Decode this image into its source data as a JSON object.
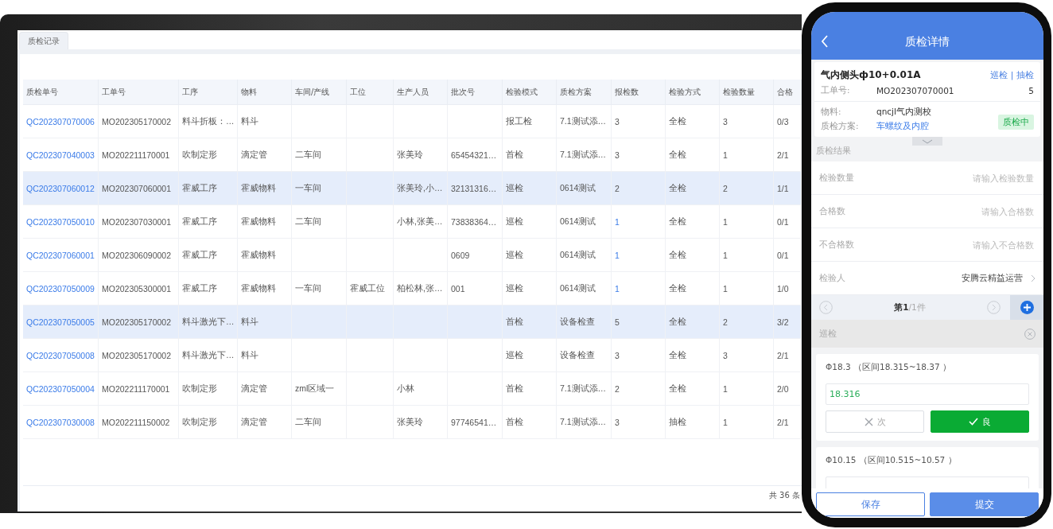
{
  "desktop": {
    "tabs": [
      {
        "label": "质检记录",
        "selected": true
      }
    ],
    "table": {
      "columns": [
        "质检单号",
        "工单号",
        "工序",
        "物料",
        "车间/产线",
        "工位",
        "生产人员",
        "批次号",
        "检验模式",
        "质检方案",
        "报检数",
        "检验方式",
        "检验数量",
        "合格"
      ],
      "rows": [
        {
          "selected": false,
          "report_linked": false,
          "cells": [
            "QC202307070006",
            "MO202305170002",
            "料斗折板：…",
            "料斗",
            "",
            "",
            "",
            "",
            "报工检",
            "7.1测试添…",
            "3",
            "全检",
            "3",
            "0/3"
          ]
        },
        {
          "selected": false,
          "report_linked": false,
          "cells": [
            "QC202307040003",
            "MO202211170001",
            "吹制定形",
            "滴定管",
            "二车间",
            "",
            "张美玲",
            "65454321…",
            "首检",
            "7.1测试添…",
            "3",
            "全检",
            "1",
            "2/1"
          ]
        },
        {
          "selected": true,
          "report_linked": false,
          "cells": [
            "QC202307060012",
            "MO202307060001",
            "霍威工序",
            "霍威物料",
            "一车间",
            "",
            "张美玲,小…",
            "32131316…",
            "巡检",
            "0614测试",
            "2",
            "全检",
            "2",
            "1/1"
          ]
        },
        {
          "selected": false,
          "report_linked": true,
          "cells": [
            "QC202307050010",
            "MO202307030001",
            "霍威工序",
            "霍威物料",
            "二车间",
            "",
            "小林,张美…",
            "73838364…",
            "巡检",
            "0614测试",
            "1",
            "全检",
            "1",
            "0/1"
          ]
        },
        {
          "selected": false,
          "report_linked": true,
          "cells": [
            "QC202307060001",
            "MO202306090002",
            "霍威工序",
            "霍威物料",
            "",
            "",
            "",
            "0609",
            "巡检",
            "0614测试",
            "1",
            "全检",
            "1",
            "0/1"
          ]
        },
        {
          "selected": false,
          "report_linked": true,
          "cells": [
            "QC202307050009",
            "MO202305300001",
            "霍威工序",
            "霍威物料",
            "一车间",
            "霍威工位",
            "柏松林,张…",
            "001",
            "巡检",
            "0614测试",
            "1",
            "全检",
            "1",
            "1/0"
          ]
        },
        {
          "selected": true,
          "report_linked": false,
          "cells": [
            "QC202307050005",
            "MO202305170002",
            "料斗激光下…",
            "料斗",
            "",
            "",
            "",
            "",
            "首检",
            "设备检查",
            "5",
            "全检",
            "2",
            "3/2"
          ]
        },
        {
          "selected": false,
          "report_linked": false,
          "cells": [
            "QC202307050008",
            "MO202305170002",
            "料斗激光下…",
            "料斗",
            "",
            "",
            "",
            "",
            "巡检",
            "设备检查",
            "3",
            "全检",
            "3",
            "2/1"
          ]
        },
        {
          "selected": false,
          "report_linked": false,
          "cells": [
            "QC202307050004",
            "MO202211170001",
            "吹制定形",
            "滴定管",
            "zml区域一",
            "",
            "小林",
            "",
            "首检",
            "7.1测试添…",
            "2",
            "全检",
            "1",
            "2/0"
          ]
        },
        {
          "selected": false,
          "report_linked": false,
          "cells": [
            "QC202307030008",
            "MO202211150002",
            "吹制定形",
            "滴定管",
            "二车间",
            "",
            "张美玲",
            "97746541…",
            "首检",
            "7.1测试添…",
            "3",
            "抽检",
            "1",
            "2/1"
          ]
        }
      ]
    },
    "total": "共 36 条"
  },
  "phone": {
    "title": "质检详情",
    "product": "气内侧头ф10+0.01A",
    "modes": "巡检 | 抽检",
    "order": {
      "label": "工单号:",
      "value": "MO202307070001",
      "count": "5"
    },
    "material": {
      "label": "物料:",
      "value": "qncjl气内测校"
    },
    "plan": {
      "label": "质检方案:",
      "value": "车螺纹及内腔"
    },
    "status": "质检中",
    "results_heading": "质检结果",
    "form": [
      {
        "kind": "input",
        "label": "检验数量",
        "placeholder": "请输入检验数量"
      },
      {
        "kind": "input",
        "label": "合格数",
        "placeholder": "请输入合格数"
      },
      {
        "kind": "input",
        "label": "不合格数",
        "placeholder": "请输入不合格数"
      },
      {
        "kind": "select",
        "label": "检验人",
        "value": "安腾云精益运营"
      }
    ],
    "pager": {
      "current": "第1",
      "total": "/1件"
    },
    "group": "巡检",
    "measurements": [
      {
        "spec": "Φ18.3 （区间18.315~18.37 ）",
        "value": "18.316",
        "verdicts": [
          {
            "kind": "reject",
            "label": "次",
            "selected": false
          },
          {
            "kind": "accept",
            "label": "良",
            "selected": true
          }
        ]
      },
      {
        "spec": "Φ10.15 （区间10.515~10.57 ）"
      }
    ],
    "buttons": [
      {
        "kind": "secondary",
        "label": "保存"
      },
      {
        "kind": "primary",
        "label": "提交"
      }
    ]
  }
}
